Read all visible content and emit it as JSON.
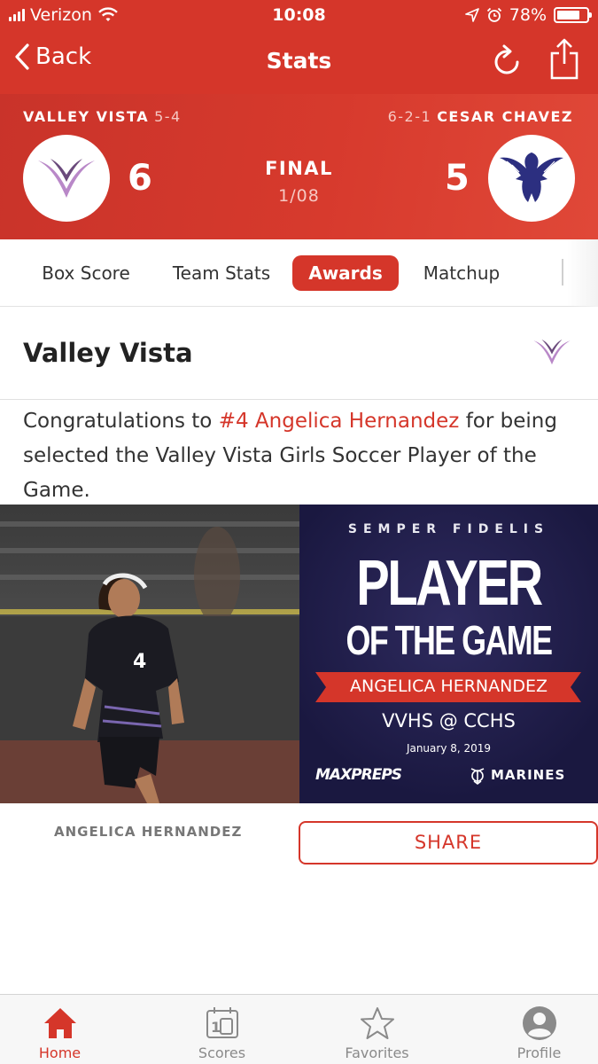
{
  "status_bar": {
    "carrier": "Verizon",
    "time": "10:08",
    "battery": "78%",
    "battery_level": 0.78
  },
  "nav": {
    "back_label": "Back",
    "title": "Stats"
  },
  "game": {
    "home": {
      "name": "VALLEY VISTA",
      "record": "5-4",
      "score": "6"
    },
    "away": {
      "name": "CESAR CHAVEZ",
      "record": "6-2-1",
      "score": "5"
    },
    "status": "FINAL",
    "date": "1/08"
  },
  "tabs": [
    {
      "label": "Box Score"
    },
    {
      "label": "Team Stats"
    },
    {
      "label": "Awards",
      "active": true
    },
    {
      "label": "Matchup"
    }
  ],
  "award": {
    "team_title": "Valley Vista",
    "text_before": "Congratulations to ",
    "player_link": "#4 Angelica Hernandez",
    "text_after": " for being selected the Valley Vista Girls Soccer Player of the Game.",
    "graphic": {
      "tagline": "SEMPER FIDELIS",
      "headline_1": "PLAYER",
      "headline_2": "OF THE GAME",
      "player_name": "ANGELICA HERNANDEZ",
      "matchup": "VVHS @ CCHS",
      "date": "January 8, 2019",
      "brand_left": "MAXPREPS",
      "brand_right": "MARINES"
    },
    "caption": "ANGELICA HERNANDEZ",
    "share_label": "SHARE"
  },
  "tab_bar": [
    {
      "label": "Home",
      "icon": "home-icon",
      "active": true
    },
    {
      "label": "Scores",
      "icon": "scoreboard-icon"
    },
    {
      "label": "Favorites",
      "icon": "star-icon"
    },
    {
      "label": "Profile",
      "icon": "profile-icon"
    }
  ],
  "colors": {
    "brand_red": "#d5362a",
    "graphic_navy": "#1a1840",
    "valley_vista_purple": "#b988c8",
    "cesar_chavez_navy": "#2c2f80"
  }
}
